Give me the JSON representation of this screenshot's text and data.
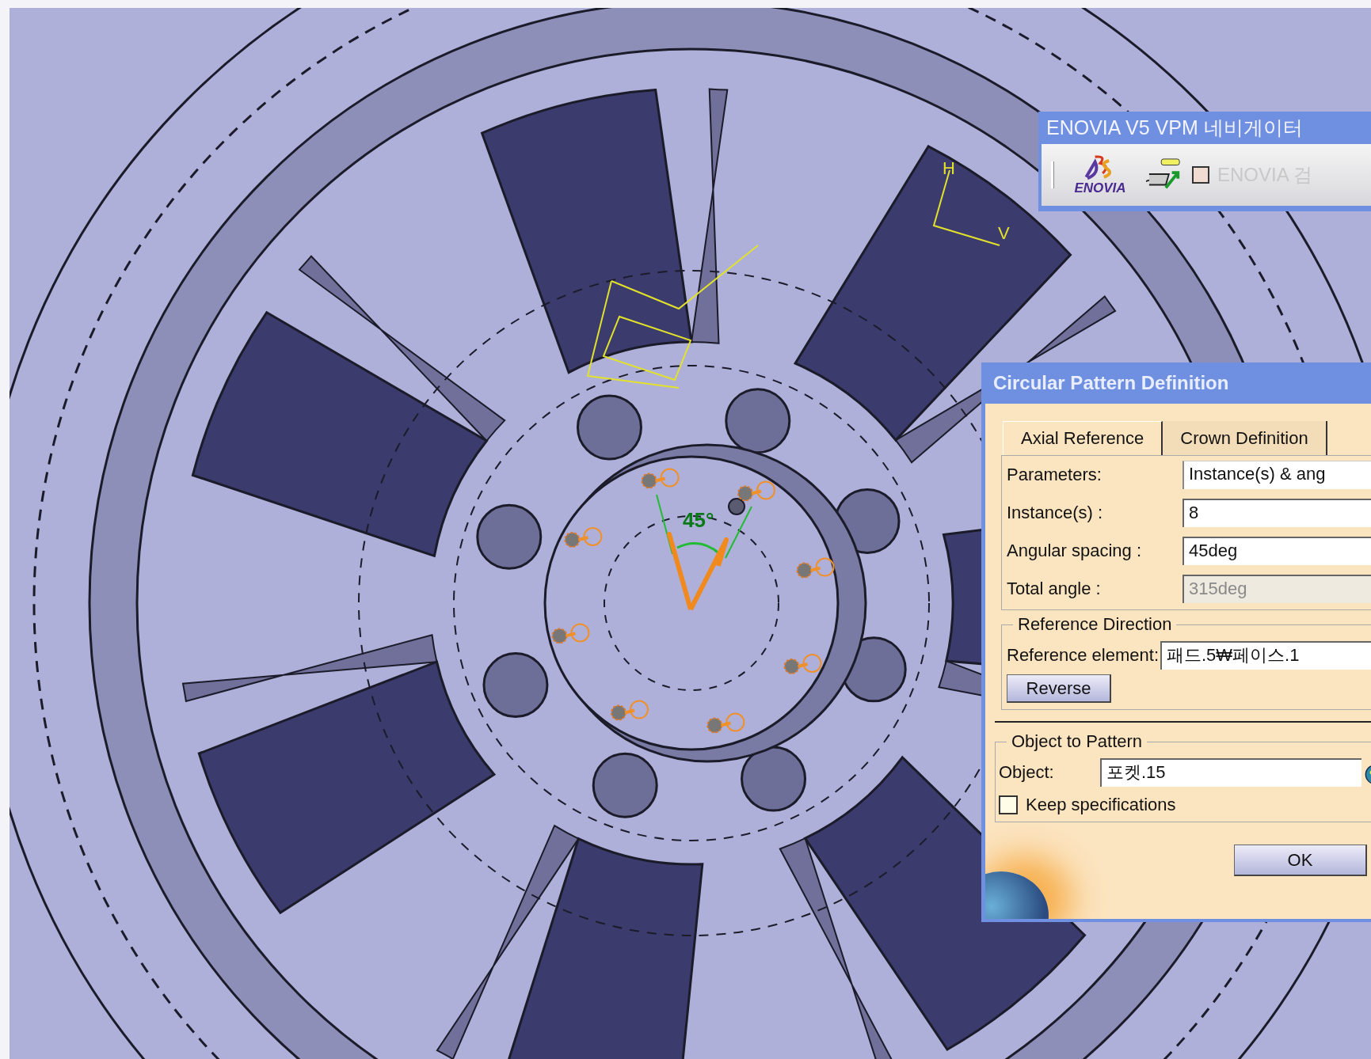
{
  "viewport": {
    "angle_label": "45°",
    "axis_labels": [
      "H",
      "V"
    ]
  },
  "navigator": {
    "title": "ENOVIA V5 VPM 네비게이터",
    "logo_text": "ENOVIA",
    "search_checkbox": {
      "label": "ENOVIA 검",
      "checked": false,
      "disabled": true
    }
  },
  "dialog": {
    "title": "Circular Pattern Definition",
    "tabs": [
      {
        "label": "Axial Reference",
        "selected": true
      },
      {
        "label": "Crown Definition",
        "selected": false
      }
    ],
    "fields": [
      {
        "label": "Parameters:",
        "value": "Instance(s) & ang",
        "kind": "combo",
        "disabled": false
      },
      {
        "label": "Instance(s) :",
        "value": "8",
        "kind": "input",
        "disabled": false
      },
      {
        "label": "Angular spacing :",
        "value": "45deg",
        "kind": "input",
        "disabled": false
      },
      {
        "label": "Total angle :",
        "value": "315deg",
        "kind": "input",
        "disabled": true
      }
    ],
    "reference_direction": {
      "title": "Reference Direction",
      "element_label": "Reference element:",
      "element_value": "패드.5₩페이스.1",
      "button": "Reverse"
    },
    "object_to_pattern": {
      "title": "Object to Pattern",
      "object_label": "Object:",
      "object_value": "포켓.15",
      "keep_specifications": {
        "label": "Keep specifications",
        "checked": false
      }
    },
    "ok_button": "OK"
  }
}
